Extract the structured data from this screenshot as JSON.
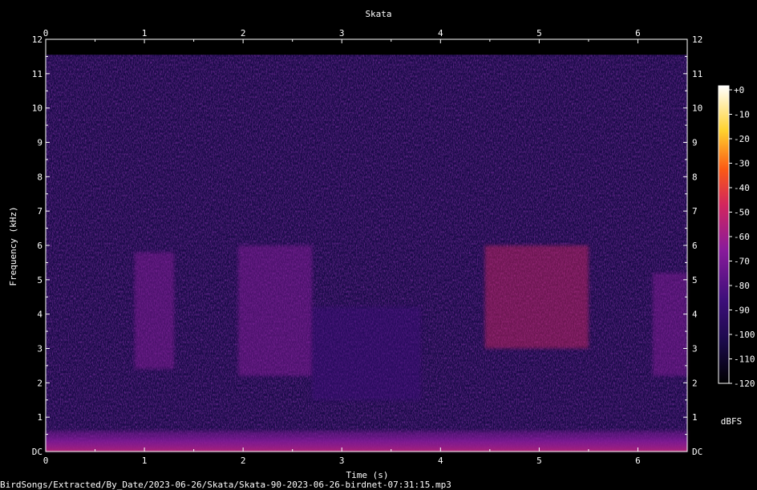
{
  "chart_data": {
    "type": "heatmap",
    "title": "Skata",
    "xlabel": "Time (s)",
    "ylabel": "Frequency (kHz)",
    "xlim": [
      0,
      6.5
    ],
    "ylim": [
      0,
      12
    ],
    "x_ticks": [
      "0",
      "1",
      "2",
      "3",
      "4",
      "5",
      "6"
    ],
    "y_ticks": [
      "DC",
      "1",
      "2",
      "3",
      "4",
      "5",
      "6",
      "7",
      "8",
      "9",
      "10",
      "11",
      "12"
    ],
    "colorbar": {
      "label": "dBFS",
      "range": [
        -120,
        0
      ],
      "ticks": [
        "+0",
        "-10",
        "-20",
        "-30",
        "-40",
        "-50",
        "-60",
        "-70",
        "-80",
        "-90",
        "-100",
        "-110",
        "-120"
      ]
    },
    "grid": false,
    "background_color": "#1a0a48",
    "colormap": [
      "#000000",
      "#1b0a4a",
      "#3d0f7a",
      "#8a1b9b",
      "#d2265e",
      "#fb5a14",
      "#ffd22e",
      "#ffffff"
    ],
    "notable_energy": [
      {
        "t_start": 0.9,
        "t_end": 1.3,
        "f_low": 2.4,
        "f_high": 5.8,
        "level_db": -75
      },
      {
        "t_start": 1.95,
        "t_end": 2.7,
        "f_low": 2.2,
        "f_high": 6.0,
        "level_db": -65
      },
      {
        "t_start": 2.7,
        "t_end": 3.8,
        "f_low": 1.5,
        "f_high": 4.2,
        "level_db": -85
      },
      {
        "t_start": 4.45,
        "t_end": 5.5,
        "f_low": 3.0,
        "f_high": 6.0,
        "level_db": -60
      },
      {
        "t_start": 6.15,
        "t_end": 6.5,
        "f_low": 2.2,
        "f_high": 5.2,
        "level_db": -75
      },
      {
        "t_start": 0.0,
        "t_end": 6.5,
        "f_low": 0.0,
        "f_high": 0.6,
        "level_db": -70
      }
    ]
  },
  "footer": {
    "file_path": "BirdSongs/Extracted/By_Date/2023-06-26/Skata/Skata-90-2023-06-26-birdnet-07:31:15.mp3"
  }
}
